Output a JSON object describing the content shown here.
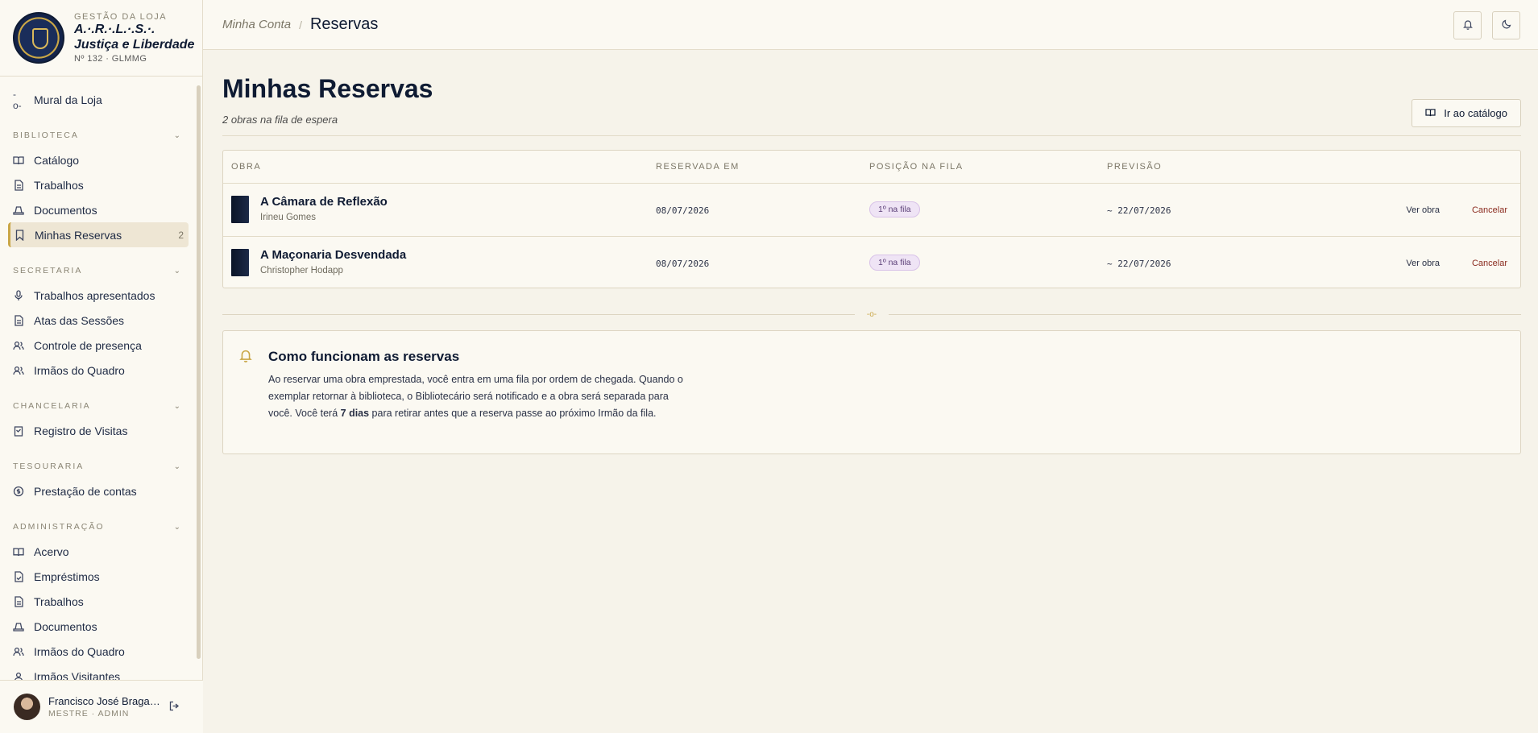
{
  "brand": {
    "kicker": "GESTÃO DA LOJA",
    "name_line1": "A.·.R.·.L.·.S.·.",
    "name_line2": "Justiça e Liberdade",
    "sub": "Nº 132 · GLMMG"
  },
  "nav": {
    "mural": "Mural da Loja",
    "sections": [
      {
        "label": "BIBLIOTECA",
        "items": [
          "Catálogo",
          "Trabalhos",
          "Documentos",
          "Minhas Reservas"
        ]
      },
      {
        "label": "SECRETARIA",
        "items": [
          "Trabalhos apresentados",
          "Atas das Sessões",
          "Controle de presença",
          "Irmãos do Quadro"
        ]
      },
      {
        "label": "CHANCELARIA",
        "items": [
          "Registro de Visitas"
        ]
      },
      {
        "label": "TESOURARIA",
        "items": [
          "Prestação de contas"
        ]
      },
      {
        "label": "ADMINISTRAÇÃO",
        "items": [
          "Acervo",
          "Empréstimos",
          "Trabalhos",
          "Documentos",
          "Irmãos do Quadro",
          "Irmãos Visitantes"
        ]
      }
    ],
    "reservas_badge": "2"
  },
  "user": {
    "name": "Francisco José Bragança",
    "role": "MESTRE · ADMIN"
  },
  "breadcrumb": {
    "parent": "Minha Conta",
    "current": "Reservas"
  },
  "page": {
    "title": "Minhas Reservas",
    "subtitle": "2 obras na fila de espera",
    "catalog_button": "Ir ao catálogo"
  },
  "table": {
    "headers": [
      "OBRA",
      "RESERVADA EM",
      "POSIÇÃO NA FILA",
      "PREVISÃO"
    ],
    "rows": [
      {
        "title": "A Câmara de Reflexão",
        "author": "Irineu Gomes",
        "reserved": "08/07/2026",
        "position": "1º na fila",
        "forecast": "~ 22/07/2026",
        "view": "Ver obra",
        "cancel": "Cancelar"
      },
      {
        "title": "A Maçonaria Desvendada",
        "author": "Christopher Hodapp",
        "reserved": "08/07/2026",
        "position": "1º na fila",
        "forecast": "~ 22/07/2026",
        "view": "Ver obra",
        "cancel": "Cancelar"
      }
    ]
  },
  "info": {
    "title": "Como funcionam as reservas",
    "body_before": "Ao reservar uma obra emprestada, você entra em uma fila por ordem de chegada. Quando o exemplar retornar à biblioteca, o Bibliotecário será notificado e a obra será separada para você. Você terá ",
    "body_bold": "7 dias",
    "body_after": " para retirar antes que a reserva passe ao próximo Irmão da fila."
  },
  "icons": {
    "mural": "commit-icon",
    "bell": "bell-icon",
    "theme": "moon-icon",
    "logout": "logout-icon",
    "catalog": "book-open-icon"
  },
  "colors": {
    "accent_gold": "#c9a646",
    "navy": "#0f1b33",
    "cancel": "#8a2a1e",
    "pill": "#efe4f5"
  }
}
